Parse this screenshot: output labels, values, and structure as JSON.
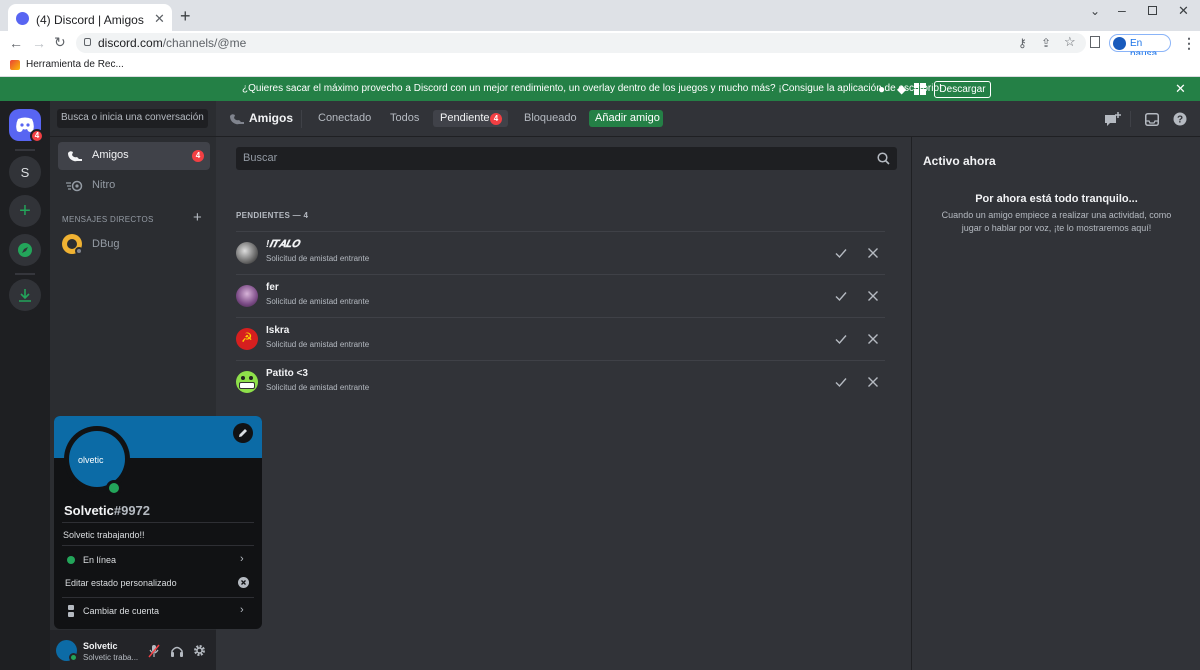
{
  "browser": {
    "tab_title": "(4) Discord | Amigos",
    "url_host": "discord.com",
    "url_path": "/channels/@me",
    "bookmark": "Herramienta de Rec...",
    "profile_status": "En pausa"
  },
  "banner": {
    "text": "¿Quieres sacar el máximo provecho a Discord con un mejor rendimiento, un overlay dentro de los juegos y mucho más? ¡Consigue la aplicación de escritorio!",
    "button": "Descargar"
  },
  "servers": {
    "home_badge": "4",
    "server_s": "S"
  },
  "sidebar": {
    "search_placeholder": "Busca o inicia una conversación",
    "friends_label": "Amigos",
    "friends_badge": "4",
    "nitro_label": "Nitro",
    "dm_header": "MENSAJES DIRECTOS",
    "dm_user": "DBug"
  },
  "topbar": {
    "title": "Amigos",
    "tab_online": "Conectado",
    "tab_all": "Todos",
    "tab_pending": "Pendiente",
    "pending_badge": "4",
    "tab_blocked": "Bloqueado",
    "add_friend": "Añadir amigo"
  },
  "pending": {
    "search_placeholder": "Buscar",
    "header": "PENDIENTES — 4",
    "requests": [
      {
        "name": "!𝑰𝑻𝑨𝑳𝑶",
        "status": "Solicitud de amistad entrante"
      },
      {
        "name": "fer",
        "status": "Solicitud de amistad entrante"
      },
      {
        "name": "Iskra",
        "status": "Solicitud de amistad entrante"
      },
      {
        "name": "Patito <3",
        "status": "Solicitud de amistad entrante"
      }
    ]
  },
  "active_now": {
    "title": "Activo ahora",
    "empty_title": "Por ahora está todo tranquilo...",
    "empty_line1": "Cuando un amigo empiece a realizar una actividad, como",
    "empty_line2": "jugar o hablar por voz, ¡te lo mostraremos aquí!"
  },
  "profile_popout": {
    "avatar_text": "olvetic",
    "username": "Solvetic",
    "discriminator": "#9972",
    "custom_status": "Solvetic trabajando!!",
    "status_online": "En línea",
    "edit_status": "Editar estado personalizado",
    "switch_account": "Cambiar de cuenta"
  },
  "userbar": {
    "name": "Solvetic",
    "status": "Solvetic traba..."
  },
  "colors": {
    "discord_blurple": "#5865f2",
    "banner_green": "#248046",
    "online_green": "#23a55a",
    "danger_red": "#f23f43",
    "profile_banner": "#0c6ba6"
  }
}
